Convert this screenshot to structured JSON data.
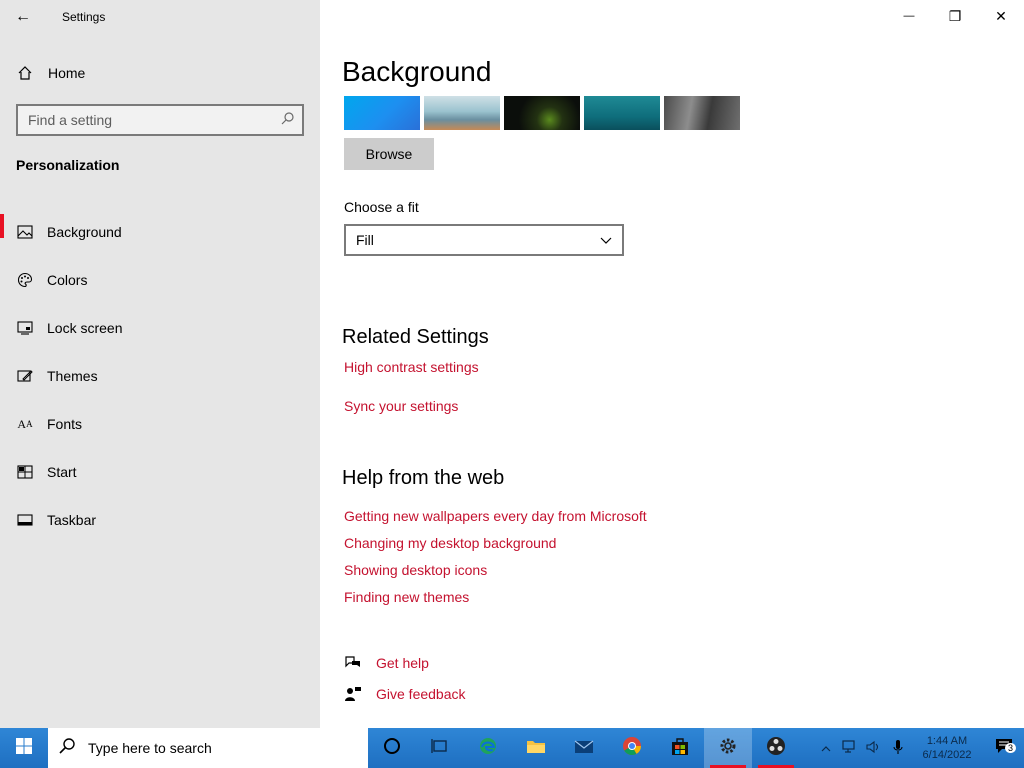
{
  "window": {
    "title": "Settings",
    "back_icon": "←",
    "minimize_icon": "—",
    "restore_icon": "❐",
    "close_icon": "✕"
  },
  "sidebar": {
    "home_label": "Home",
    "search_placeholder": "Find a setting",
    "section_title": "Personalization",
    "items": [
      {
        "label": "Background",
        "icon": "image-icon",
        "active": true
      },
      {
        "label": "Colors",
        "icon": "palette-icon"
      },
      {
        "label": "Lock screen",
        "icon": "lock-screen-icon"
      },
      {
        "label": "Themes",
        "icon": "themes-icon"
      },
      {
        "label": "Fonts",
        "icon": "fonts-icon"
      },
      {
        "label": "Start",
        "icon": "start-icon"
      },
      {
        "label": "Taskbar",
        "icon": "taskbar-icon"
      }
    ]
  },
  "main": {
    "title": "Background",
    "browse_label": "Browse",
    "fit_label": "Choose a fit",
    "fit_value": "Fill",
    "related_title": "Related Settings",
    "related_links": [
      "High contrast settings",
      "Sync your settings"
    ],
    "help_title": "Help from the web",
    "help_links": [
      "Getting new wallpapers every day from Microsoft",
      "Changing my desktop background",
      "Showing desktop icons",
      "Finding new themes"
    ],
    "get_help": "Get help",
    "give_feedback": "Give feedback"
  },
  "taskbar": {
    "search_placeholder": "Type here to search",
    "time": "1:44 AM",
    "date": "6/14/2022",
    "notification_count": "3"
  },
  "colors": {
    "accent": "#e81123",
    "link": "#c4122f",
    "sidebar_bg": "#e6e6e6",
    "taskbar": "#1e6fc1"
  }
}
